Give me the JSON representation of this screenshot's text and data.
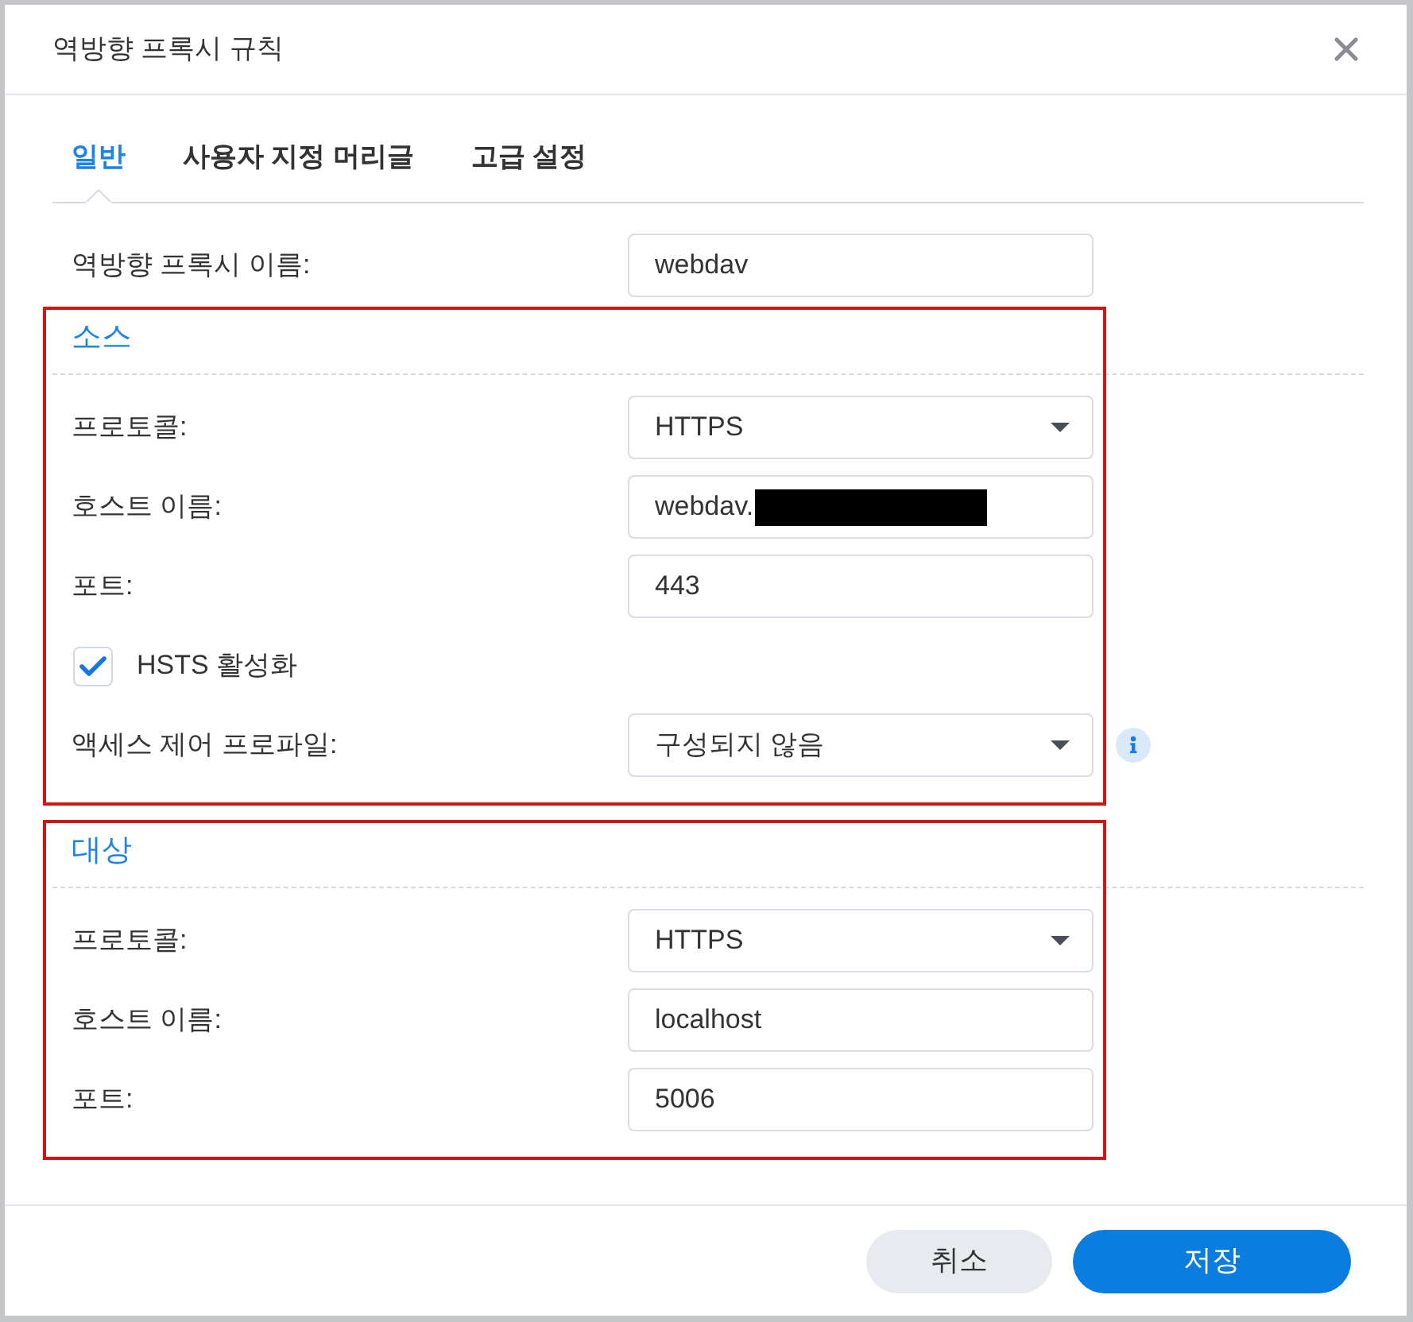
{
  "window": {
    "title": "역방향 프록시 규칙"
  },
  "tabs": [
    {
      "label": "일반",
      "selected": true
    },
    {
      "label": "사용자 지정 머리글",
      "selected": false
    },
    {
      "label": "고급 설정",
      "selected": false
    }
  ],
  "name_field": {
    "label": "역방향 프록시 이름:",
    "value": "webdav"
  },
  "sections": [
    {
      "title": "소스",
      "highlighted": true,
      "rows": [
        {
          "kind": "select",
          "label": "프로토콜:",
          "value": "HTTPS"
        },
        {
          "kind": "input",
          "label": "호스트 이름:",
          "value": "webdav.",
          "redacted": true
        },
        {
          "kind": "input",
          "label": "포트:",
          "value": "443"
        },
        {
          "kind": "checkbox",
          "label": "HSTS 활성화",
          "checked": true
        },
        {
          "kind": "select",
          "label": "액세스 제어 프로파일:",
          "value": "구성되지 않음",
          "info": true
        }
      ]
    },
    {
      "title": "대상",
      "highlighted": true,
      "rows": [
        {
          "kind": "select",
          "label": "프로토콜:",
          "value": "HTTPS"
        },
        {
          "kind": "input",
          "label": "호스트 이름:",
          "value": "localhost"
        },
        {
          "kind": "input",
          "label": "포트:",
          "value": "5006"
        }
      ]
    }
  ],
  "buttons": [
    {
      "label": "취소",
      "kind": "secondary"
    },
    {
      "label": "저장",
      "kind": "primary"
    }
  ]
}
